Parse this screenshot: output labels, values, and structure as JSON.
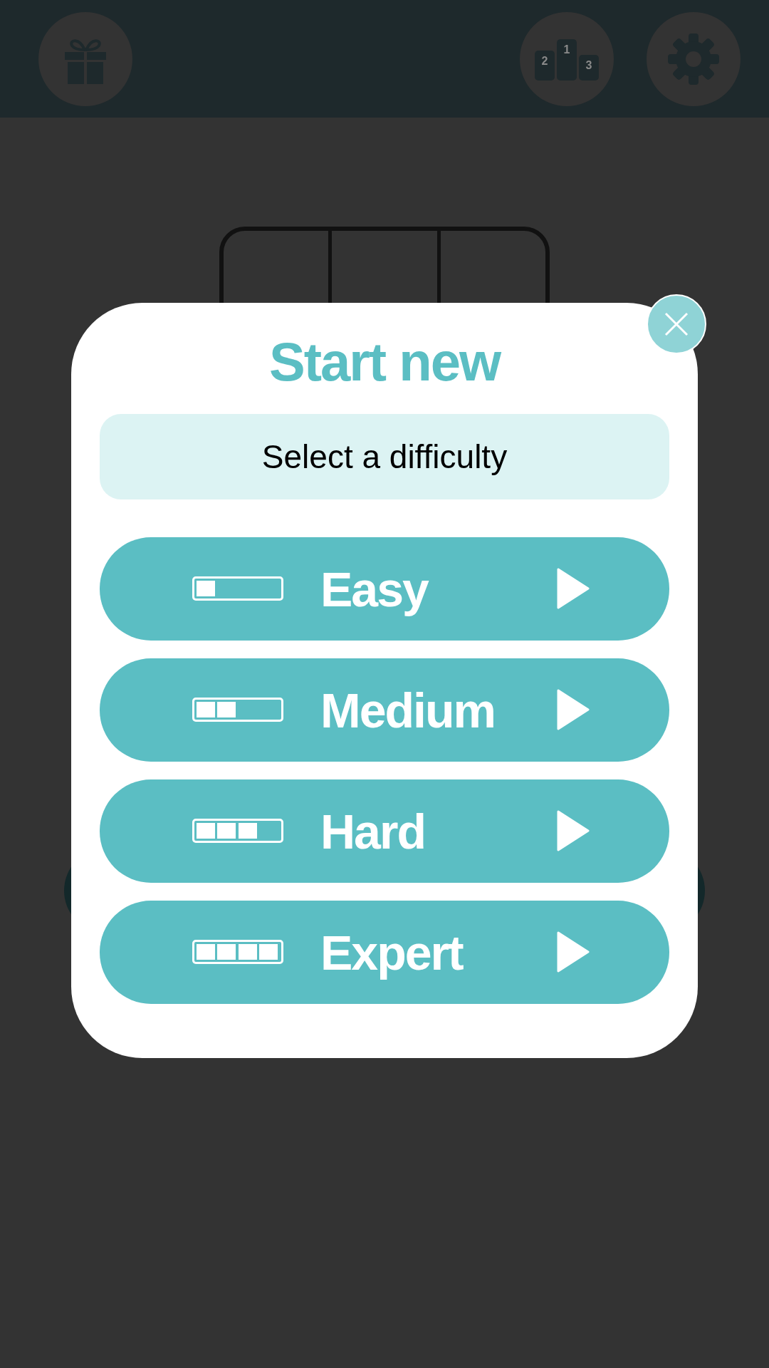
{
  "top_bar": {
    "buttons": [
      {
        "kind": "gift"
      },
      {
        "kind": "podium",
        "labels": [
          "2",
          "1",
          "3"
        ]
      },
      {
        "kind": "settings"
      }
    ]
  },
  "dialog": {
    "title": "Start new",
    "subtitle": "Select a difficulty",
    "options": [
      {
        "label": "Easy",
        "level": 0.25
      },
      {
        "label": "Medium",
        "level": 0.5
      },
      {
        "label": "Hard",
        "level": 0.75
      },
      {
        "label": "Expert",
        "level": 1
      }
    ]
  }
}
